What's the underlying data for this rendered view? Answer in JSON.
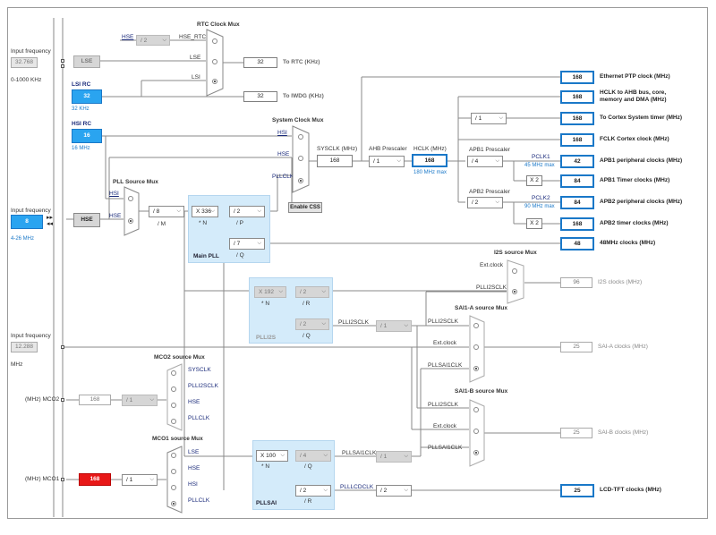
{
  "rtc_mux": {
    "title": "RTC Clock Mux",
    "hse_rtc": "HSE_RTC",
    "hse": "HSE",
    "lse": "LSE",
    "lsi": "LSI",
    "div": "/ 2"
  },
  "lse": {
    "input_label": "Input frequency",
    "value": "32.768",
    "range": "0-1000 KHz",
    "button": "LSE"
  },
  "lsi": {
    "title": "LSI RC",
    "value": "32",
    "unit": "32 KHz"
  },
  "hsi": {
    "title": "HSI RC",
    "value": "16",
    "unit": "16 MHz"
  },
  "rtc_out": {
    "value": "32",
    "label": "To RTC (KHz)"
  },
  "iwdg_out": {
    "value": "32",
    "label": "To IWDG (KHz)"
  },
  "sys_mux": {
    "title": "System Clock Mux",
    "hsi": "HSI",
    "hse": "HSE",
    "pllclk": "PLLCLK"
  },
  "sysclk": {
    "label": "SYSCLK (MHz)",
    "value": "168"
  },
  "ahb": {
    "label": "AHB Prescaler",
    "value": "/ 1"
  },
  "hclk": {
    "label": "HCLK (MHz)",
    "value": "168",
    "note": "180 MHz max"
  },
  "apb1": {
    "label": "APB1 Prescaler",
    "value": "/ 4",
    "pclk": "PCLK1",
    "note": "45 MHz max"
  },
  "apb2": {
    "label": "APB2 Prescaler",
    "value": "/ 2",
    "pclk": "PCLK2",
    "note": "90 MHz max"
  },
  "cortex_div": "/ 1",
  "timer_mul1": "X 2",
  "timer_mul2": "X 2",
  "outputs": [
    {
      "value": "168",
      "label": "Ethernet PTP clock (MHz)"
    },
    {
      "value": "168",
      "label": "HCLK to AHB bus, core,",
      "label2": "memory and DMA (MHz)"
    },
    {
      "value": "168",
      "label": "To Cortex System timer (MHz)"
    },
    {
      "value": "168",
      "label": "FCLK Cortex clock (MHz)"
    },
    {
      "value": "42",
      "label": "APB1 peripheral clocks (MHz)"
    },
    {
      "value": "84",
      "label": "APB1 Timer clocks (MHz)"
    },
    {
      "value": "84",
      "label": "APB2 peripheral clocks (MHz)"
    },
    {
      "value": "168",
      "label": "APB2 timer clocks (MHz)"
    },
    {
      "value": "48",
      "label": "48MHz clocks (MHz)"
    }
  ],
  "hse": {
    "input_label": "Input frequency",
    "value": "8",
    "range": "4-26 MHz",
    "button": "HSE"
  },
  "pll_mux": {
    "title": "PLL Source Mux",
    "hsi": "HSI",
    "hse": "HSE"
  },
  "main_pll": {
    "title": "Main PLL",
    "m": "/ 8",
    "m_lbl": "/ M",
    "n": "X 336",
    "n_lbl": "* N",
    "p": "/ 2",
    "p_lbl": "/ P",
    "q": "/ 7",
    "q_lbl": "/ Q"
  },
  "css": "Enable CSS",
  "i2s_mux": {
    "title": "I2S source Mux",
    "ext": "Ext.clock",
    "plli2s": "PLLI2SCLK"
  },
  "i2s_out": {
    "value": "96",
    "label": "I2S clocks (MHz)"
  },
  "plli2s": {
    "title": "PLLI2S",
    "n": "X 192",
    "n_lbl": "* N",
    "r": "/ 2",
    "r_lbl": "/ R",
    "q": "/ 2",
    "q_lbl": "/ Q",
    "clk": "PLLI2SCLK",
    "div": "/ 1"
  },
  "sai_a_mux": {
    "title": "SAI1-A source Mux",
    "plli2s": "PLLI2SCLK",
    "ext": "Ext.clock",
    "pllsai": "PLLSAI1CLK"
  },
  "sai_a_out": {
    "value": "25",
    "label": "SAI-A clocks (MHz)"
  },
  "sai_b_mux": {
    "title": "SAI1-B source Mux",
    "plli2s": "PLLI2SCLK",
    "ext": "Ext.clock",
    "pllsai": "PLLSAI1CLK"
  },
  "sai_b_out": {
    "value": "25",
    "label": "SAI-B clocks (MHz)"
  },
  "ext_in": {
    "input_label": "Input frequency",
    "value": "12.288",
    "unit": "MHz"
  },
  "mco2": {
    "title": "MCO2 source Mux",
    "sysclk": "SYSCLK",
    "plli2s": "PLLI2SCLK",
    "hse": "HSE",
    "pll": "PLLCLK",
    "value": "168",
    "div": "/ 1",
    "pin": "(MHz) MCO2"
  },
  "mco1": {
    "title": "MCO1 source Mux",
    "lse": "LSE",
    "hse": "HSE",
    "hsi": "HSI",
    "pll": "PLLCLK",
    "value": "168",
    "div": "/ 1",
    "pin": "(MHz) MCO1"
  },
  "pllsai": {
    "title": "PLLSAI",
    "n": "X 100",
    "n_lbl": "* N",
    "q": "/ 4",
    "q_lbl": "/ Q",
    "r": "/ 2",
    "r_lbl": "/ R",
    "sai_clk": "PLLSAI1CLK",
    "sai_div": "/ 1",
    "lcd_clk": "PLLLCDCLK",
    "lcd_div": "/ 2"
  },
  "lcd_out": {
    "value": "25",
    "label": "LCD-TFT clocks (MHz)"
  },
  "colors": {
    "accent": "#1a78c8",
    "source_on": "#2aa4f0",
    "panel": "#d4ebfa",
    "alert": "#e81818"
  }
}
